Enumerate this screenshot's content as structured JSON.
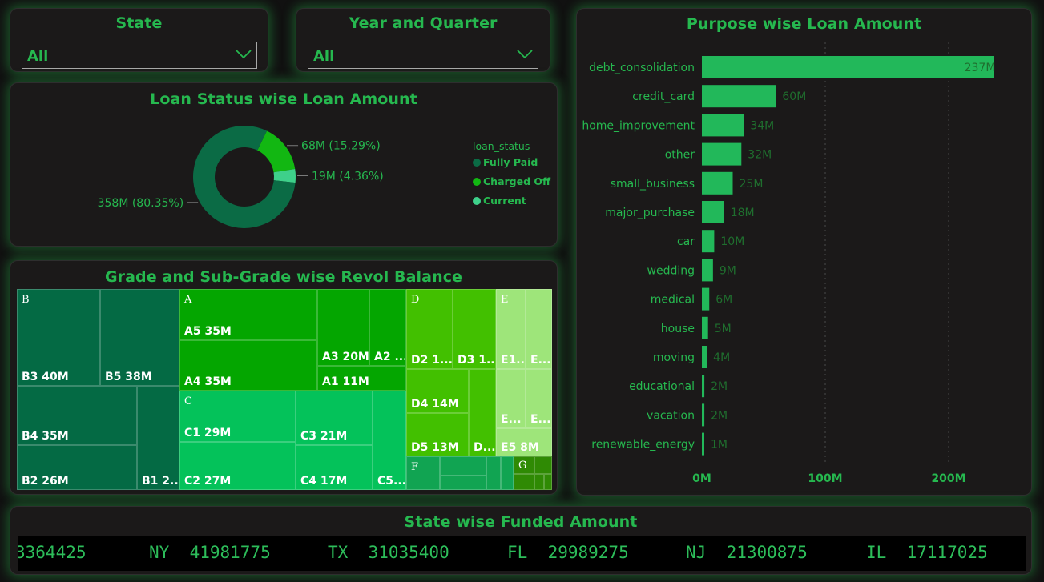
{
  "slicers": {
    "state": {
      "title": "State",
      "value": "All",
      "icon": "chevron-down-icon"
    },
    "year_quarter": {
      "title": "Year and Quarter",
      "value": "All",
      "icon": "chevron-down-icon"
    }
  },
  "loan_status": {
    "title": "Loan Status wise Loan Amount",
    "legend_title": "loan_status",
    "chart_data": {
      "type": "pie",
      "donut": true,
      "categories": [
        "Fully Paid",
        "Charged Off",
        "Current"
      ],
      "values": [
        358,
        68,
        19
      ],
      "unit": "M",
      "percents": [
        80.35,
        15.29,
        4.36
      ],
      "data_labels": [
        "358M (80.35%)",
        "68M (15.29%)",
        "19M (4.36%)"
      ],
      "colors": [
        "#0b6b45",
        "#12b712",
        "#3ed08a"
      ],
      "legend_position": "right"
    }
  },
  "purpose": {
    "title": "Purpose wise Loan Amount",
    "chart_data": {
      "type": "bar",
      "orientation": "horizontal",
      "categories": [
        "debt_consolidation",
        "credit_card",
        "home_improvement",
        "other",
        "small_business",
        "major_purchase",
        "car",
        "wedding",
        "medical",
        "house",
        "moving",
        "educational",
        "vacation",
        "renewable_energy"
      ],
      "values": [
        237,
        60,
        34,
        32,
        25,
        18,
        10,
        9,
        6,
        5,
        4,
        2,
        2,
        1
      ],
      "data_labels": [
        "237M",
        "60M",
        "34M",
        "32M",
        "25M",
        "18M",
        "10M",
        "9M",
        "6M",
        "5M",
        "4M",
        "2M",
        "2M",
        "1M"
      ],
      "x_ticks": [
        "0M",
        "100M",
        "200M"
      ],
      "xlim": [
        0,
        260
      ],
      "grid": "vertical dotted",
      "bar_color": "#22b85a"
    }
  },
  "treemap": {
    "title": "Grade and Sub-Grade wise Revol Balance",
    "group_labels": {
      "B": "B",
      "A": "A",
      "C": "C",
      "D": "D",
      "E": "E",
      "F": "F",
      "G": "G"
    },
    "cell_labels": {
      "B3": "B3 40M",
      "B5": "B5 38M",
      "B4": "B4 35M",
      "B2": "B2 26M",
      "B1": "B1 2...",
      "A5": "A5 35M",
      "A4": "A4 35M",
      "A3": "A3 20M",
      "A2": "A2 ...",
      "A1": "A1 11M",
      "C1": "C1 29M",
      "C2": "C2 27M",
      "C3": "C3 21M",
      "C4": "C4 17M",
      "C5": "C5...",
      "D2": "D2 1...",
      "D3": "D3 1...",
      "D4": "D4 14M",
      "D5": "D5 13M",
      "D1": "D...",
      "E1": "E1...",
      "E2": "E...",
      "E3": "E...",
      "E4": "E...",
      "E5": "E5 8M"
    },
    "colors": {
      "B": "#046a44",
      "A": "#04a600",
      "C": "#04c25a",
      "D": "#42c000",
      "E": "#9ee57a",
      "F": "#11a452",
      "G": "#2f8a04"
    }
  },
  "state_funded": {
    "title": "State wise Funded Amount",
    "items": [
      "3364425",
      "NY  41981775",
      "TX  31035400",
      "FL  29989275",
      "NJ  21300875",
      "IL  17117025"
    ]
  }
}
